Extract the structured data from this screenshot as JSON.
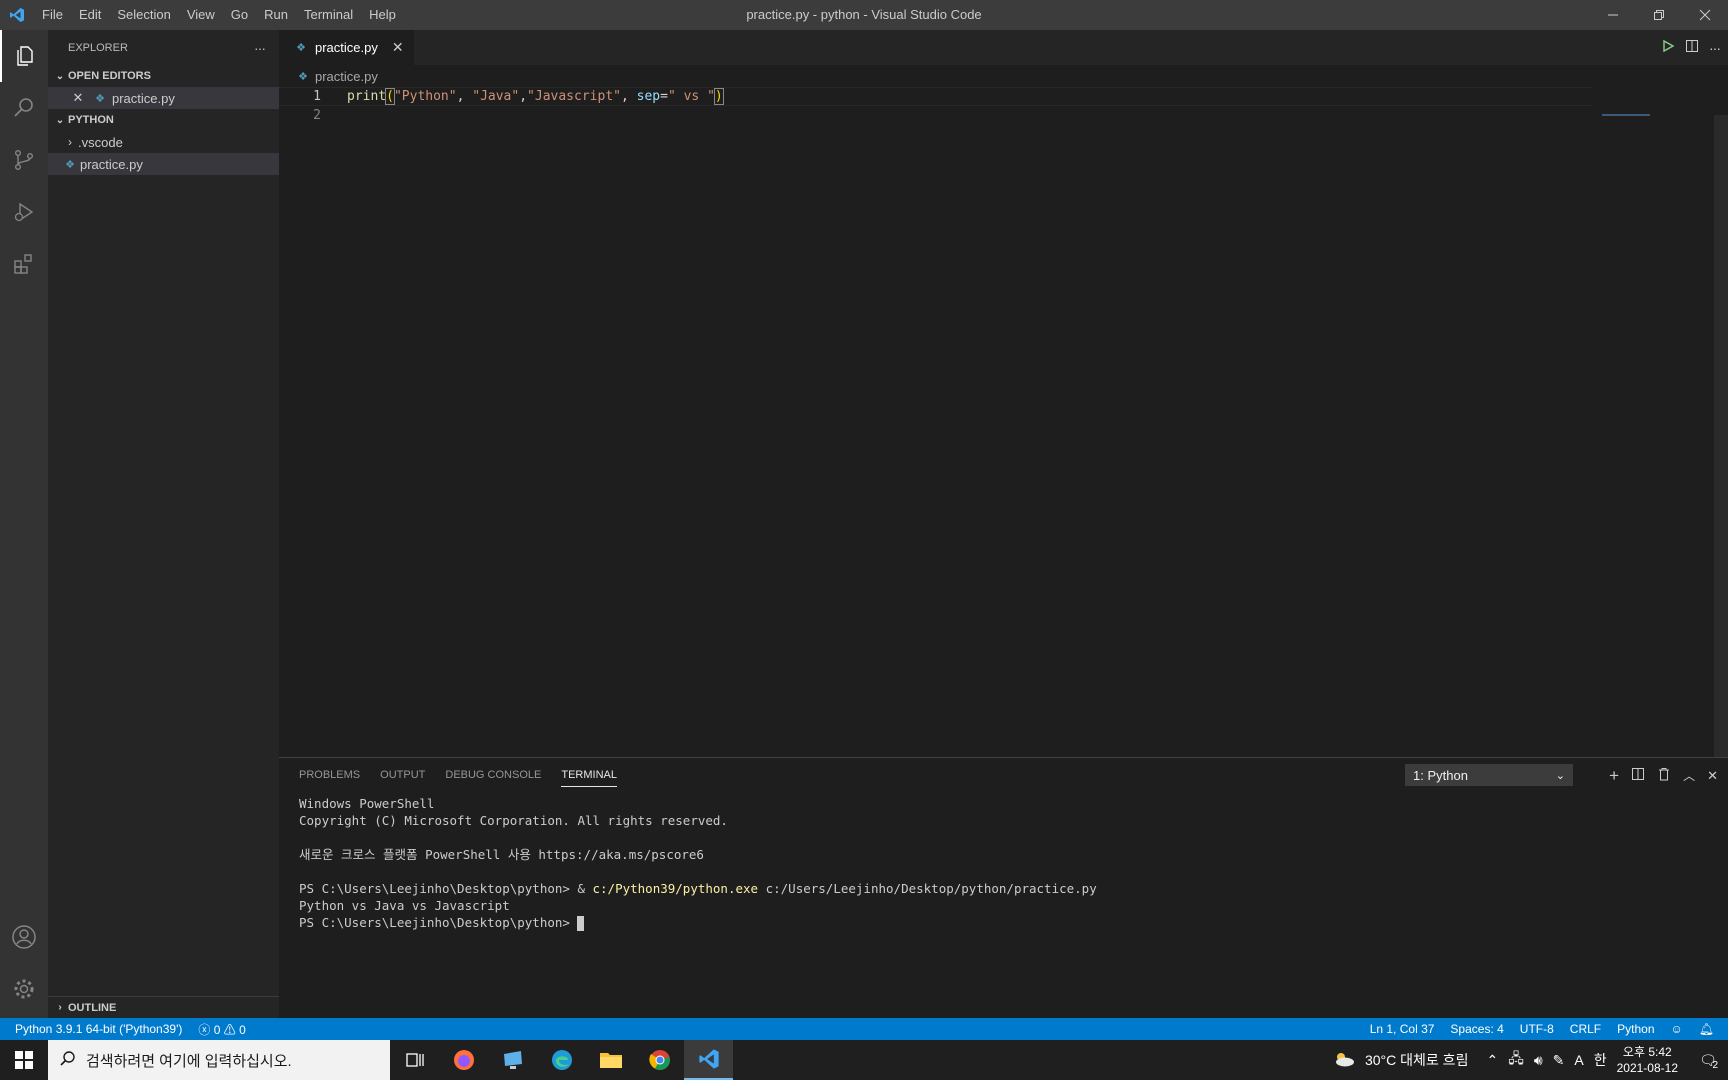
{
  "window": {
    "title": "practice.py - python - Visual Studio Code"
  },
  "menu": [
    "File",
    "Edit",
    "Selection",
    "View",
    "Go",
    "Run",
    "Terminal",
    "Help"
  ],
  "sidebar": {
    "title": "EXPLORER",
    "more": "···",
    "open_editors": {
      "header": "OPEN EDITORS",
      "item": "practice.py"
    },
    "folder": {
      "header": "PYTHON",
      "items": [
        ".vscode",
        "practice.py"
      ]
    },
    "outline": "OUTLINE"
  },
  "editor": {
    "tab": "practice.py",
    "breadcrumb": "practice.py",
    "line_numbers": [
      "1",
      "2"
    ],
    "code": {
      "fn": "print",
      "open": "(",
      "s1": "\"Python\"",
      "c1": ", ",
      "s2": "\"Java\"",
      "c2": ",",
      "s3": "\"Javascript\"",
      "c3": ", ",
      "param": "sep",
      "eq": "=",
      "s4": "\" vs \"",
      "close": ")"
    }
  },
  "panel": {
    "tabs": [
      "PROBLEMS",
      "OUTPUT",
      "DEBUG CONSOLE",
      "TERMINAL"
    ],
    "active_tab": "TERMINAL",
    "terminal_select": "1: Python",
    "terminal": {
      "l1": "Windows PowerShell",
      "l2": "Copyright (C) Microsoft Corporation. All rights reserved.",
      "l3": "새로운 크로스 플랫폼 PowerShell 사용 https://aka.ms/pscore6",
      "l4_prompt": "PS C:\\Users\\Leejinho\\Desktop\\python> & ",
      "l4_exe": "c:/Python39/python.exe",
      "l4_arg": " c:/Users/Leejinho/Desktop/python/practice.py",
      "l5": "Python vs Java vs Javascript",
      "l6": "PS C:\\Users\\Leejinho\\Desktop\\python> "
    }
  },
  "status": {
    "interpreter": "Python 3.9.1 64-bit ('Python39')",
    "errors": "0",
    "warnings": "0",
    "position": "Ln 1, Col 37",
    "spaces": "Spaces: 4",
    "encoding": "UTF-8",
    "eol": "CRLF",
    "language": "Python"
  },
  "taskbar": {
    "search_placeholder": "검색하려면 여기에 입력하십시오.",
    "weather": "30°C 대체로 흐림",
    "ime": "A",
    "ime2": "한",
    "time": "오후 5:42",
    "date": "2021-08-12",
    "notifications": "2"
  },
  "colors": {
    "accent": "#007acc",
    "activity_bar": "#333333",
    "sidebar": "#252526",
    "editor": "#1e1e1e"
  }
}
